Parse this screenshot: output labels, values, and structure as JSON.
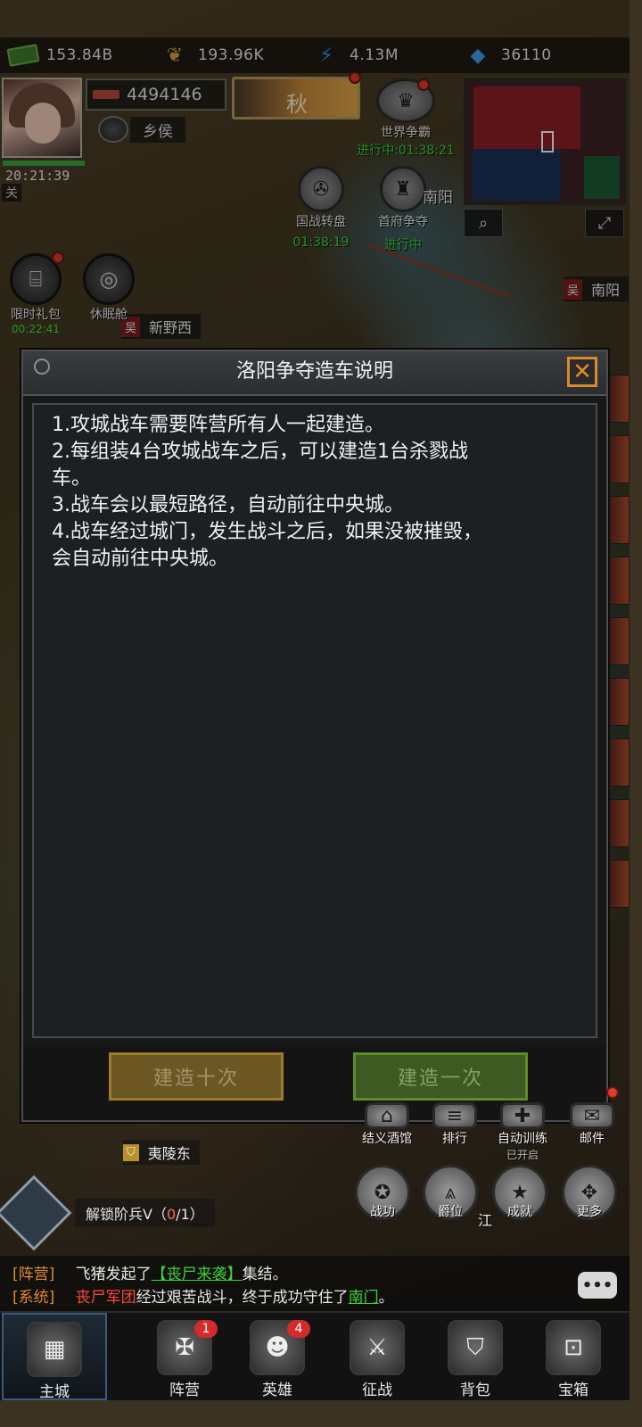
{
  "resources": [
    {
      "icon": "cash-icon",
      "value": "153.84B"
    },
    {
      "icon": "wheat-icon",
      "value": "193.96K"
    },
    {
      "icon": "lightning-icon",
      "value": "4.13M"
    },
    {
      "icon": "diamond-icon",
      "value": "36110"
    }
  ],
  "player": {
    "power": "4494146",
    "rank": "乡侯",
    "time": "20:21:39",
    "faction_short": "关",
    "xp_fraction": 1.0
  },
  "season": {
    "label": "秋"
  },
  "map_buttons": {
    "world_battle": {
      "label": "世界争霸",
      "timer": "进行中:01:38:21"
    },
    "nation_wheel": {
      "label": "国战转盘",
      "timer": "01:38:19"
    },
    "capital_fight": {
      "label": "首府争夺",
      "timer": "进行中"
    },
    "nanyang_label": "南阳"
  },
  "map_tags": {
    "xinye": {
      "faction": "吴",
      "name": "新野西"
    },
    "nanyang2": {
      "faction": "吴",
      "name": "南阳"
    },
    "yiling": {
      "faction": "",
      "name": "夷陵东"
    }
  },
  "side_buttons": {
    "gift": {
      "label": "限时礼包",
      "timer": "00:22:41"
    },
    "sleep": {
      "label": "休眠舱"
    }
  },
  "modal": {
    "title": "洛阳争夺造车说明",
    "lines": [
      "1.攻城战车需要阵营所有人一起建造。",
      "2.每组装4台攻城战车之后，可以建造1台杀戮战",
      "车。",
      "3.战车会以最短路径，自动前往中央城。",
      "4.战车经过城门，发生战斗之后，如果没被摧毁，",
      "会自动前往中央城。"
    ],
    "btn_ten": "建造十次",
    "btn_one": "建造一次"
  },
  "right_menu": {
    "tavern": "结义酒馆",
    "ranking": "排行",
    "auto_train": "自动训练",
    "auto_train_status": "已开启",
    "mail": "邮件",
    "merit": "战功",
    "title": "爵位",
    "jiang": "江",
    "achievement": "成就",
    "more": "更多"
  },
  "unlock": {
    "text": "解锁阶兵V（",
    "progress": "0",
    "rest": "/1）"
  },
  "chat": [
    {
      "channel": "[阵营]",
      "prefix": "飞猪发起了",
      "link": "【丧尸来袭】",
      "suffix": "集结。"
    },
    {
      "channel": "[系统]",
      "prefix": "丧尸军团",
      "middle": "经过艰苦战斗，终于成功守住了",
      "link": "南门",
      "suffix": "。"
    }
  ],
  "chat_button": "•••",
  "nav": [
    {
      "label": "主城",
      "icon": "city-icon",
      "badge": ""
    },
    {
      "label": "阵营",
      "icon": "faction-icon",
      "badge": "1"
    },
    {
      "label": "英雄",
      "icon": "hero-icon",
      "badge": "4"
    },
    {
      "label": "征战",
      "icon": "battle-icon",
      "badge": ""
    },
    {
      "label": "背包",
      "icon": "backpack-icon",
      "badge": ""
    },
    {
      "label": "宝箱",
      "icon": "chest-icon",
      "badge": ""
    }
  ]
}
